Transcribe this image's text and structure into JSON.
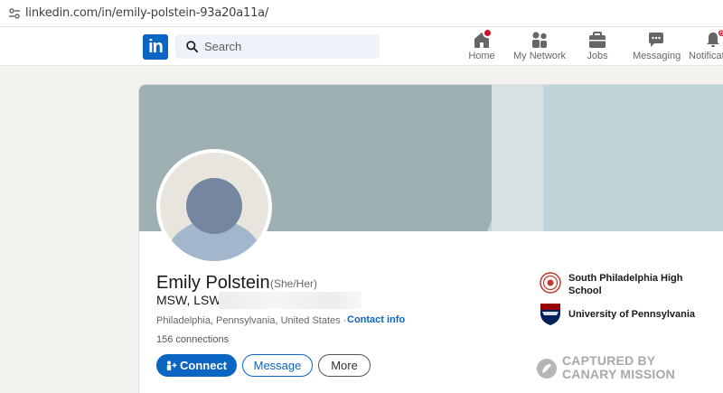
{
  "browser": {
    "url": "linkedin.com/in/emily-polstein-93a20a11a/"
  },
  "header": {
    "logo": "in",
    "search": {
      "placeholder": "Search",
      "value": ""
    },
    "nav": [
      {
        "label": "Home",
        "icon": "home-icon",
        "badge": ""
      },
      {
        "label": "My Network",
        "icon": "people-icon",
        "badge": ""
      },
      {
        "label": "Jobs",
        "icon": "briefcase-icon",
        "badge": ""
      },
      {
        "label": "Messaging",
        "icon": "chat-icon",
        "badge": ""
      },
      {
        "label": "Notificati",
        "icon": "bell-icon",
        "badge": "6"
      }
    ]
  },
  "profile": {
    "name": "Emily Polstein",
    "pronouns": "(She/Her)",
    "headline": "MSW, LSW |",
    "location": "Philadelphia, Pennsylvania, United States · ",
    "contact_info": "Contact info",
    "connections": "156 connections",
    "actions": {
      "connect": "Connect",
      "message": "Message",
      "more": "More"
    },
    "education": [
      {
        "name": "South Philadelphia High School"
      },
      {
        "name": "University of Pennsylvania"
      }
    ]
  },
  "watermark": {
    "line1": "CAPTURED BY",
    "line2": "CANARY MISSION"
  },
  "colors": {
    "brand": "#0a66c2",
    "badge": "#cb112d",
    "banner": "#9fb0b3"
  }
}
